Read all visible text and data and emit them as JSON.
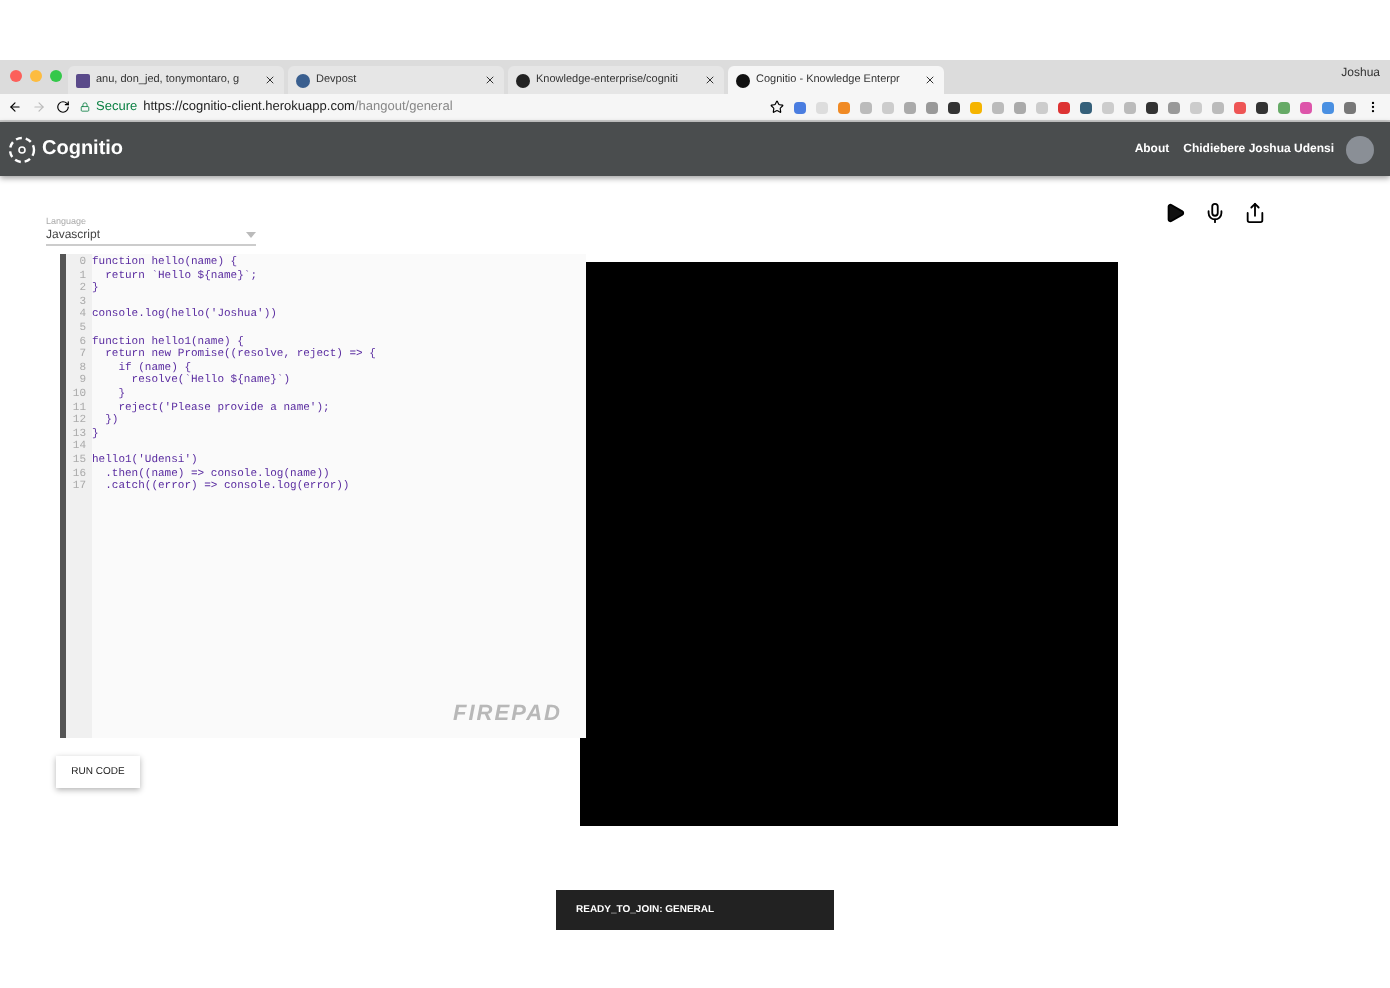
{
  "browser": {
    "tabs": [
      {
        "title": "anu, don_jed, tonymontaro, g",
        "selected": false
      },
      {
        "title": "Devpost",
        "selected": false
      },
      {
        "title": "Knowledge-enterprise/cogniti",
        "selected": false
      },
      {
        "title": "Cognitio - Knowledge Enterpr",
        "selected": true
      }
    ],
    "profile": "Joshua",
    "secure_label": "Secure",
    "url_host": "https://cognitio-client.herokuapp.com",
    "url_path": "/hangout/general"
  },
  "app": {
    "brand": "Cognitio",
    "nav": [
      "About",
      "Chidiebere Joshua Udensi"
    ]
  },
  "language": {
    "label": "Language",
    "value": "Javascript"
  },
  "editor": {
    "watermark": "FIREPAD",
    "lines": [
      {
        "number": "0",
        "code": "function hello(name) {"
      },
      {
        "number": "1",
        "code": "  return `Hello ${name}`;"
      },
      {
        "number": "2",
        "code": "}"
      },
      {
        "number": "3"
      },
      {
        "number": "4",
        "code": "console.log(hello('Joshua'))"
      },
      {
        "number": "5"
      },
      {
        "number": "6",
        "code": "function hello1(name) {"
      },
      {
        "number": "7",
        "code": "  return new Promise((resolve, reject) => {"
      },
      {
        "number": "8",
        "code": "    if (name) {"
      },
      {
        "number": "9",
        "code": "      resolve(`Hello ${name}`)"
      },
      {
        "number": "10",
        "code": "    }"
      },
      {
        "number": "11",
        "code": "    reject('Please provide a name');"
      },
      {
        "number": "12",
        "code": "  })"
      },
      {
        "number": "13",
        "code": "}"
      },
      {
        "number": "14"
      },
      {
        "number": "15",
        "code": "hello1('Udensi')"
      },
      {
        "number": "16",
        "code": "  .then((name) => console.log(name))"
      },
      {
        "number": "17",
        "code": "  .catch((error) => console.log(error))"
      }
    ]
  },
  "run_button": "RUN CODE",
  "snackbar": "READY_TO_JOIN: GENERAL"
}
